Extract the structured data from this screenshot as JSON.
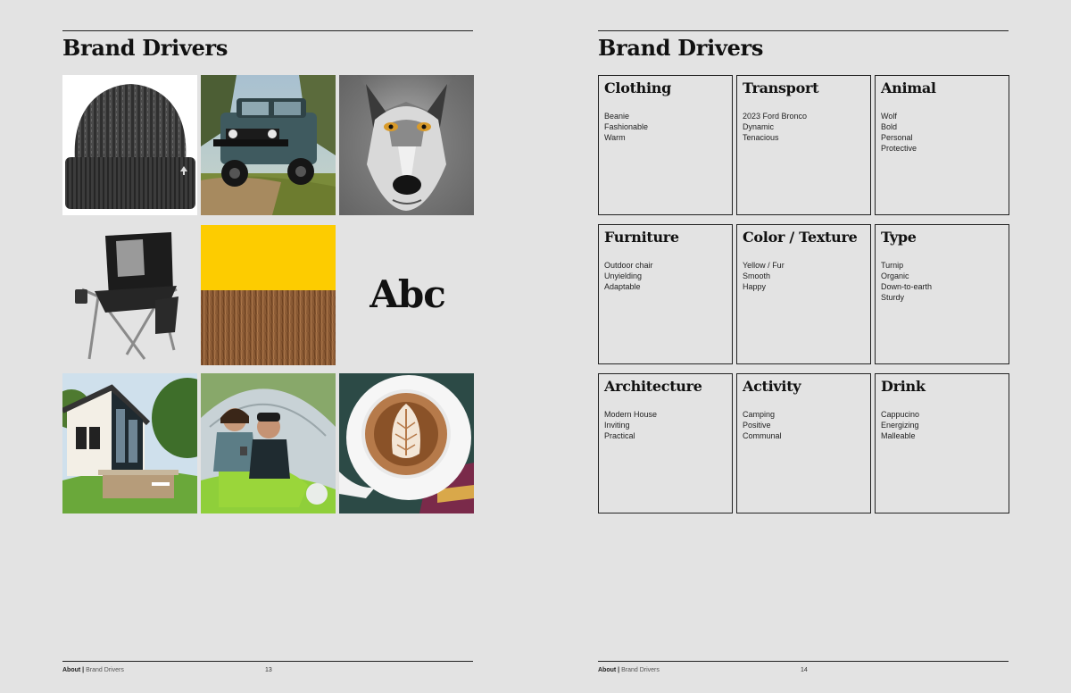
{
  "left_page": {
    "title": "Brand Drivers",
    "specimen_text": "Abc",
    "footer": {
      "section": "About",
      "subsection": "Brand Drivers",
      "page_number": "13"
    },
    "images": [
      "beanie",
      "ford-bronco",
      "wolf",
      "camping-chair",
      "yellow-swatch",
      "fur-texture",
      "modern-house",
      "camping-couple",
      "cappuccino"
    ]
  },
  "right_page": {
    "title": "Brand Drivers",
    "footer": {
      "section": "About",
      "subsection": "Brand Drivers",
      "page_number": "14"
    },
    "cards": [
      {
        "title": "Clothing",
        "items": [
          "Beanie",
          "Fashionable",
          "Warm"
        ]
      },
      {
        "title": "Transport",
        "items": [
          "2023 Ford Bronco",
          "Dynamic",
          "Tenacious"
        ]
      },
      {
        "title": "Animal",
        "items": [
          "Wolf",
          "Bold",
          "Personal",
          "Protective"
        ]
      },
      {
        "title": "Furniture",
        "items": [
          "Outdoor chair",
          "Unyielding",
          "Adaptable"
        ]
      },
      {
        "title": "Color / Texture",
        "items": [
          "Yellow / Fur",
          "Smooth",
          "Happy"
        ]
      },
      {
        "title": "Type",
        "items": [
          "Turnip",
          "Organic",
          "Down-to-earth",
          "Sturdy"
        ]
      },
      {
        "title": "Architecture",
        "items": [
          "Modern House",
          "Inviting",
          "Practical"
        ]
      },
      {
        "title": "Activity",
        "items": [
          "Camping",
          "Positive",
          "Communal"
        ]
      },
      {
        "title": "Drink",
        "items": [
          "Cappucino",
          "Energizing",
          "Malleable"
        ]
      }
    ]
  },
  "colors": {
    "background": "#e3e3e3",
    "ink": "#111111",
    "swatch_yellow": "#fdcc00",
    "fur_brown": "#8a5a34"
  }
}
